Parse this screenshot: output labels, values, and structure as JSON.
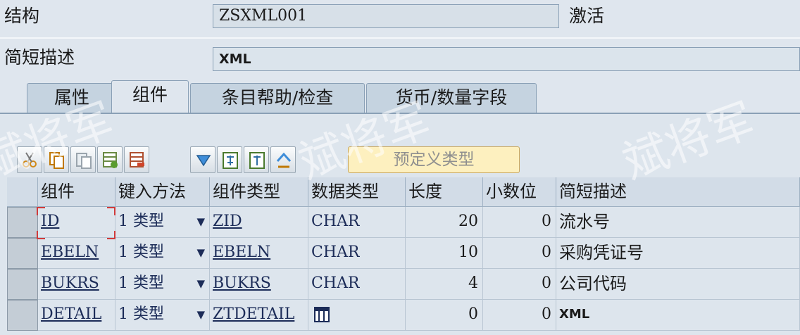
{
  "header": {
    "structure_label": "结构",
    "structure_value": "ZSXML001",
    "status": "激活",
    "desc_label": "简短描述",
    "desc_value": "XML"
  },
  "tabs": [
    {
      "label": "属性",
      "active": false
    },
    {
      "label": "组件",
      "active": true
    },
    {
      "label": "条目帮助/检查",
      "active": false
    },
    {
      "label": "货币/数量字段",
      "active": false
    }
  ],
  "toolbar": {
    "buttons": [
      "cut-icon",
      "copy-icon",
      "paste-icon",
      "insert-row-icon",
      "delete-row-icon",
      "find-icon",
      "expand-icon",
      "collapse-icon",
      "sort-icon"
    ],
    "predefined_type": "预定义类型"
  },
  "grid": {
    "columns": [
      "组件",
      "键入方法",
      "组件类型",
      "数据类型",
      "长度",
      "小数位",
      "简短描述"
    ],
    "rows": [
      {
        "component": "ID",
        "entry_method": "1 类型",
        "component_type": "ZID",
        "data_type": "CHAR",
        "length": "20",
        "decimals": "0",
        "desc": "流水号"
      },
      {
        "component": "EBELN",
        "entry_method": "1 类型",
        "component_type": "EBELN",
        "data_type": "CHAR",
        "length": "10",
        "decimals": "0",
        "desc": "采购凭证号"
      },
      {
        "component": "BUKRS",
        "entry_method": "1 类型",
        "component_type": "BUKRS",
        "data_type": "CHAR",
        "length": "4",
        "decimals": "0",
        "desc": "公司代码"
      },
      {
        "component": "DETAIL",
        "entry_method": "1 类型",
        "component_type": "ZTDETAIL",
        "data_type": "",
        "length": "0",
        "decimals": "0",
        "desc": "XML"
      }
    ]
  },
  "watermark": "斌将军",
  "colors": {
    "accent": "#1c2c58",
    "panel": "#dde5ed",
    "predefined_button": "#fdf0bf"
  }
}
